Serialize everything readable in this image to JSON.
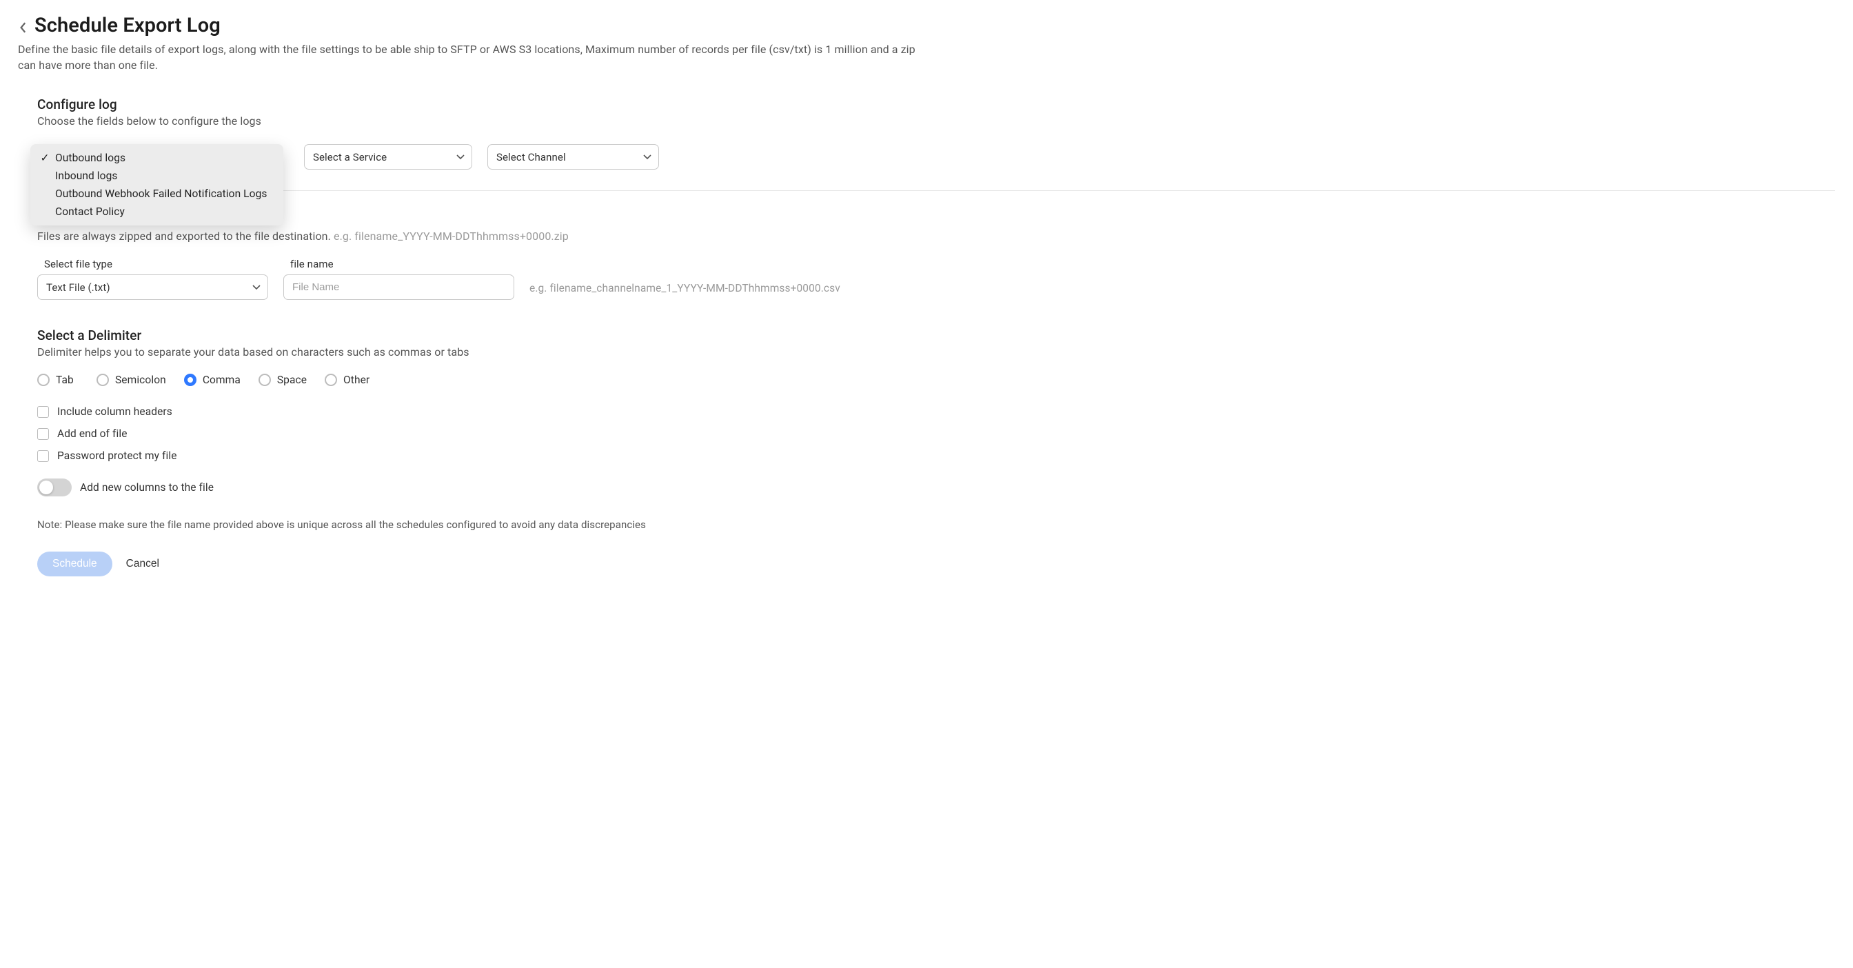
{
  "header": {
    "title": "Schedule Export Log",
    "subtitle": "Define the basic file details of export logs, along with the file settings to be able ship to SFTP or AWS S3 locations, Maximum number of records per file (csv/txt) is 1 million and a zip can have more than one file."
  },
  "configure": {
    "title": "Configure log",
    "subtitle": "Choose the fields below to configure the logs",
    "log_type_options": {
      "selected_index": 0,
      "items": [
        {
          "label": "Outbound logs"
        },
        {
          "label": "Inbound logs"
        },
        {
          "label": "Outbound Webhook Failed Notification Logs"
        },
        {
          "label": "Contact Policy"
        }
      ]
    },
    "service_select": {
      "placeholder": "Select a Service"
    },
    "channel_select": {
      "placeholder": "Select Channel"
    }
  },
  "file": {
    "desc_text": "Files are always zipped and exported to the file destination.",
    "desc_example": "e.g. filename_YYYY-MM-DDThhmmss+0000.zip",
    "type_label": "Select file type",
    "type_value": "Text File (.txt)",
    "name_label": "file name",
    "name_placeholder": "File Name",
    "name_example": "e.g. filename_channelname_1_YYYY-MM-DDThhmmss+0000.csv"
  },
  "delimiter": {
    "title": "Select a Delimiter",
    "subtitle": "Delimiter helps you to separate your data based on characters such as commas or tabs",
    "options": [
      {
        "label": "Tab",
        "checked": false
      },
      {
        "label": "Semicolon",
        "checked": false
      },
      {
        "label": "Comma",
        "checked": true
      },
      {
        "label": "Space",
        "checked": false
      },
      {
        "label": "Other",
        "checked": false
      }
    ]
  },
  "checkboxes": [
    {
      "label": "Include column headers",
      "checked": false
    },
    {
      "label": "Add end of file",
      "checked": false
    },
    {
      "label": "Password protect my file",
      "checked": false
    }
  ],
  "toggle": {
    "label": "Add new columns to the file",
    "on": false
  },
  "note": "Note: Please make sure the file name provided above is unique across all the schedules configured to avoid any data discrepancies",
  "actions": {
    "primary": "Schedule",
    "secondary": "Cancel"
  }
}
